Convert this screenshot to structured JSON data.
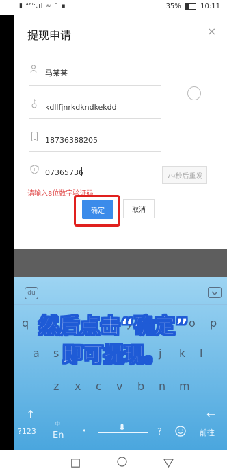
{
  "status_bar": {
    "left_text": "▮ ⁴⁶ᴳ.ıl ≈ ▯ ▪",
    "battery": "35%",
    "time": "10:11"
  },
  "dialog": {
    "title": "提现申请",
    "close_icon": "×",
    "fields": [
      {
        "icon": "user-icon",
        "value": "马某某"
      },
      {
        "icon": "key-icon",
        "value": "kdllfjnrkdkndkekdd"
      },
      {
        "icon": "phone-icon",
        "value": "18736388205"
      },
      {
        "icon": "shield-icon",
        "value": "07365736"
      }
    ],
    "resend_label": "79秒后重发",
    "error_text": "请输入8位数字验证码",
    "confirm_label": "确定",
    "cancel_label": "取消"
  },
  "keyboard": {
    "brand": "du",
    "row1": [
      "q",
      "w",
      "e",
      "r",
      "t",
      "y",
      "u",
      "i",
      "o",
      "p"
    ],
    "row2": [
      "a",
      "s",
      "d",
      "f",
      "g",
      "h",
      "j",
      "k",
      "l"
    ],
    "row3": [
      "z",
      "x",
      "c",
      "v",
      "b",
      "n",
      "m"
    ],
    "bottom": {
      "num": "?123",
      "lang_top": "中",
      "lang": "En",
      "space_dot": "•",
      "question": "?",
      "next": "前往"
    }
  },
  "caption": {
    "line1": "然后点击“确定”",
    "line2": "即可提现。"
  },
  "colors": {
    "primary": "#3b8bea",
    "error": "#e04a4a",
    "highlight": "#e0201e",
    "caption_stroke": "#1f5bd6"
  }
}
